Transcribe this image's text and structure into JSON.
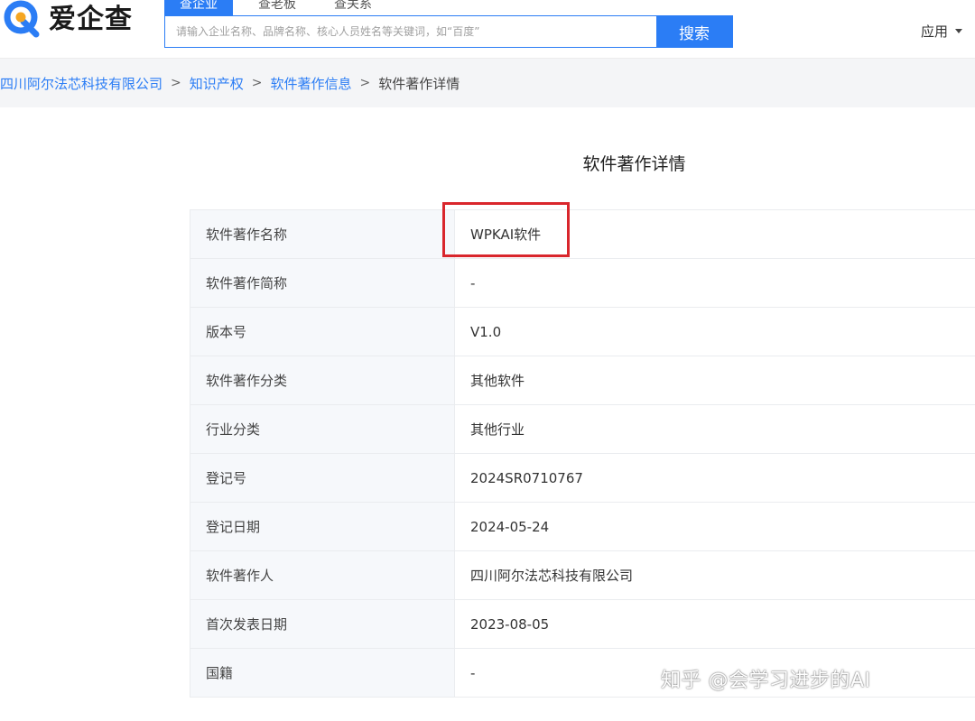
{
  "header": {
    "logo_text": "爱企查",
    "tabs": [
      {
        "label": "查企业"
      },
      {
        "label": "查老板"
      },
      {
        "label": "查关系"
      }
    ],
    "search_placeholder": "请输入企业名称、品牌名称、核心人员姓名等关键词，如“百度”",
    "search_button": "搜索",
    "apps_label": "应用"
  },
  "breadcrumb": {
    "items": [
      "四川阿尔法芯科技有限公司",
      "知识产权",
      "软件著作信息"
    ],
    "current": "软件著作详情",
    "separator": ">"
  },
  "detail": {
    "title": "软件著作详情",
    "rows": [
      {
        "label": "软件著作名称",
        "value": "WPKAI软件"
      },
      {
        "label": "软件著作简称",
        "value": "-"
      },
      {
        "label": "版本号",
        "value": "V1.0"
      },
      {
        "label": "软件著作分类",
        "value": "其他软件"
      },
      {
        "label": "行业分类",
        "value": "其他行业"
      },
      {
        "label": "登记号",
        "value": "2024SR0710767"
      },
      {
        "label": "登记日期",
        "value": "2024-05-24"
      },
      {
        "label": "软件著作人",
        "value": "四川阿尔法芯科技有限公司"
      },
      {
        "label": "首次发表日期",
        "value": "2023-08-05"
      },
      {
        "label": "国籍",
        "value": "-"
      }
    ]
  },
  "watermark": "知乎 @会学习进步的AI",
  "colors": {
    "accent": "#2b7df5",
    "highlight": "#d9262c"
  }
}
